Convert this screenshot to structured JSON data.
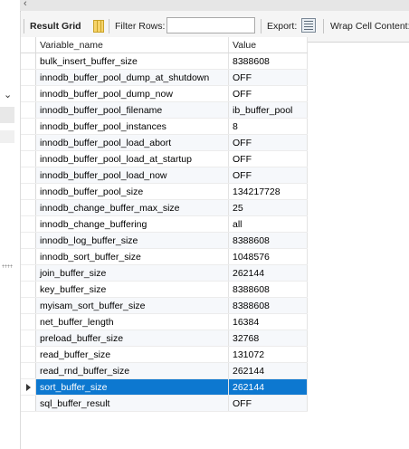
{
  "toolbar": {
    "result_grid_label": "Result Grid",
    "filter_rows_label": "Filter Rows:",
    "filter_rows_value": "",
    "export_label": "Export:",
    "wrap_label": "Wrap Cell Content:"
  },
  "grid": {
    "columns": [
      "Variable_name",
      "Value"
    ],
    "selected_row": 20,
    "rows": [
      {
        "name": "bulk_insert_buffer_size",
        "value": "8388608"
      },
      {
        "name": "innodb_buffer_pool_dump_at_shutdown",
        "value": "OFF"
      },
      {
        "name": "innodb_buffer_pool_dump_now",
        "value": "OFF"
      },
      {
        "name": "innodb_buffer_pool_filename",
        "value": "ib_buffer_pool"
      },
      {
        "name": "innodb_buffer_pool_instances",
        "value": "8"
      },
      {
        "name": "innodb_buffer_pool_load_abort",
        "value": "OFF"
      },
      {
        "name": "innodb_buffer_pool_load_at_startup",
        "value": "OFF"
      },
      {
        "name": "innodb_buffer_pool_load_now",
        "value": "OFF"
      },
      {
        "name": "innodb_buffer_pool_size",
        "value": "134217728"
      },
      {
        "name": "innodb_change_buffer_max_size",
        "value": "25"
      },
      {
        "name": "innodb_change_buffering",
        "value": "all"
      },
      {
        "name": "innodb_log_buffer_size",
        "value": "8388608"
      },
      {
        "name": "innodb_sort_buffer_size",
        "value": "1048576"
      },
      {
        "name": "join_buffer_size",
        "value": "262144"
      },
      {
        "name": "key_buffer_size",
        "value": "8388608"
      },
      {
        "name": "myisam_sort_buffer_size",
        "value": "8388608"
      },
      {
        "name": "net_buffer_length",
        "value": "16384"
      },
      {
        "name": "preload_buffer_size",
        "value": "32768"
      },
      {
        "name": "read_buffer_size",
        "value": "131072"
      },
      {
        "name": "read_rnd_buffer_size",
        "value": "262144"
      },
      {
        "name": "sort_buffer_size",
        "value": "262144"
      },
      {
        "name": "sql_buffer_result",
        "value": "OFF"
      }
    ]
  }
}
